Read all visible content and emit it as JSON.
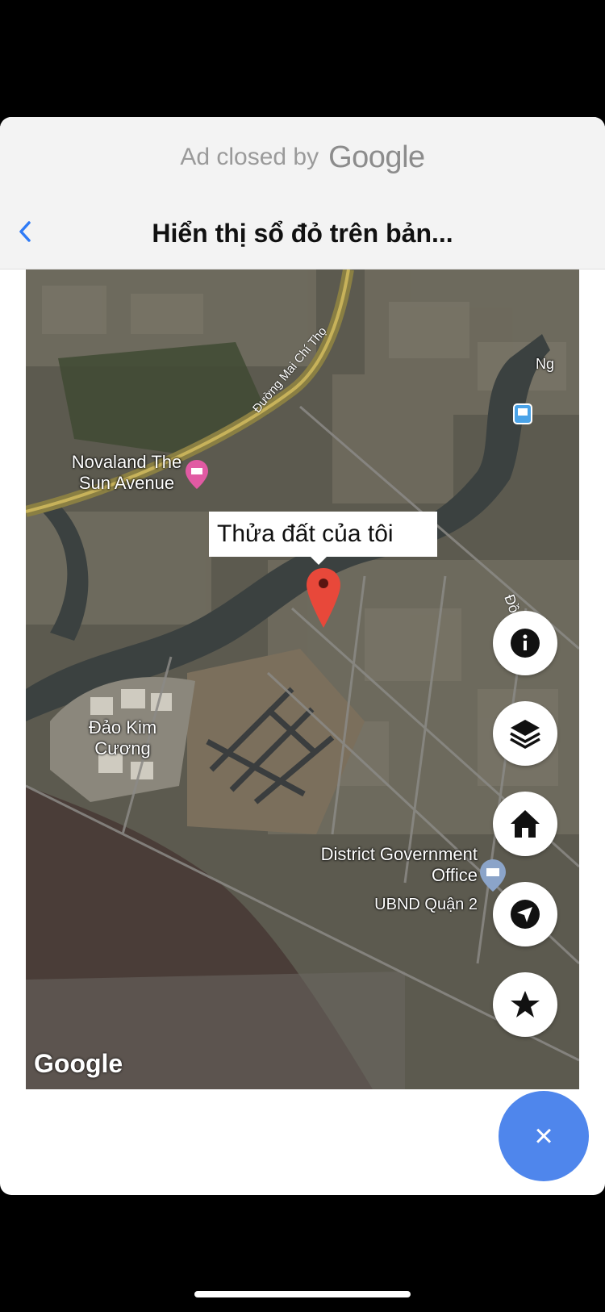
{
  "ad": {
    "closed_by": "Ad closed by",
    "brand": "Google"
  },
  "nav": {
    "back_icon": "chevron-left-icon",
    "title": "Hiển thị sổ đỏ trên bản..."
  },
  "map": {
    "labels": {
      "road": "Đường Mai Chí Thọ",
      "novaland": "Novaland The Sun Avenue",
      "dao_kim_cuong": "Đảo Kim Cương",
      "district_office": "District Government Office",
      "ubnd": "UBND Quận 2",
      "edge_right_top": "Ng",
      "edge_right_mid": "Đồn"
    },
    "callout": "Thửa đất của tôi",
    "watermark": "Google",
    "buttons": [
      "info-icon",
      "layers-icon",
      "home-icon",
      "navigation-icon",
      "star-icon"
    ]
  },
  "fab": {
    "close_label": "×"
  },
  "colors": {
    "fab": "#4f86ec",
    "pin": "#e8483a",
    "back": "#2f7bf6"
  }
}
